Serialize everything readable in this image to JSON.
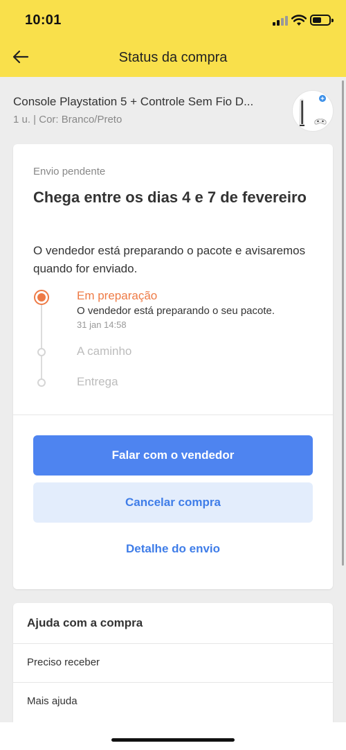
{
  "status_bar": {
    "time": "10:01"
  },
  "header": {
    "title": "Status da compra"
  },
  "product": {
    "name": "Console Playstation 5 + Controle Sem Fio D...",
    "meta": "1 u. | Cor: Branco/Preto"
  },
  "shipping": {
    "label": "Envio pendente",
    "title": "Chega entre os dias 4 e 7 de fevereiro",
    "description": "O vendedor está preparando o pacote e avisaremos quando for enviado.",
    "steps": [
      {
        "title": "Em preparação",
        "description": "O vendedor está preparando o seu pacote.",
        "time": "31 jan 14:58"
      },
      {
        "title": "A caminho"
      },
      {
        "title": "Entrega"
      }
    ]
  },
  "actions": {
    "primary": "Falar com o vendedor",
    "secondary": "Cancelar compra",
    "link": "Detalhe do envio"
  },
  "help": {
    "title": "Ajuda com a compra",
    "items": [
      "Preciso receber",
      "Mais ajuda"
    ]
  },
  "colors": {
    "header_bg": "#f9e04b",
    "accent_blue": "#4e84f0",
    "accent_orange": "#ee7a45"
  }
}
